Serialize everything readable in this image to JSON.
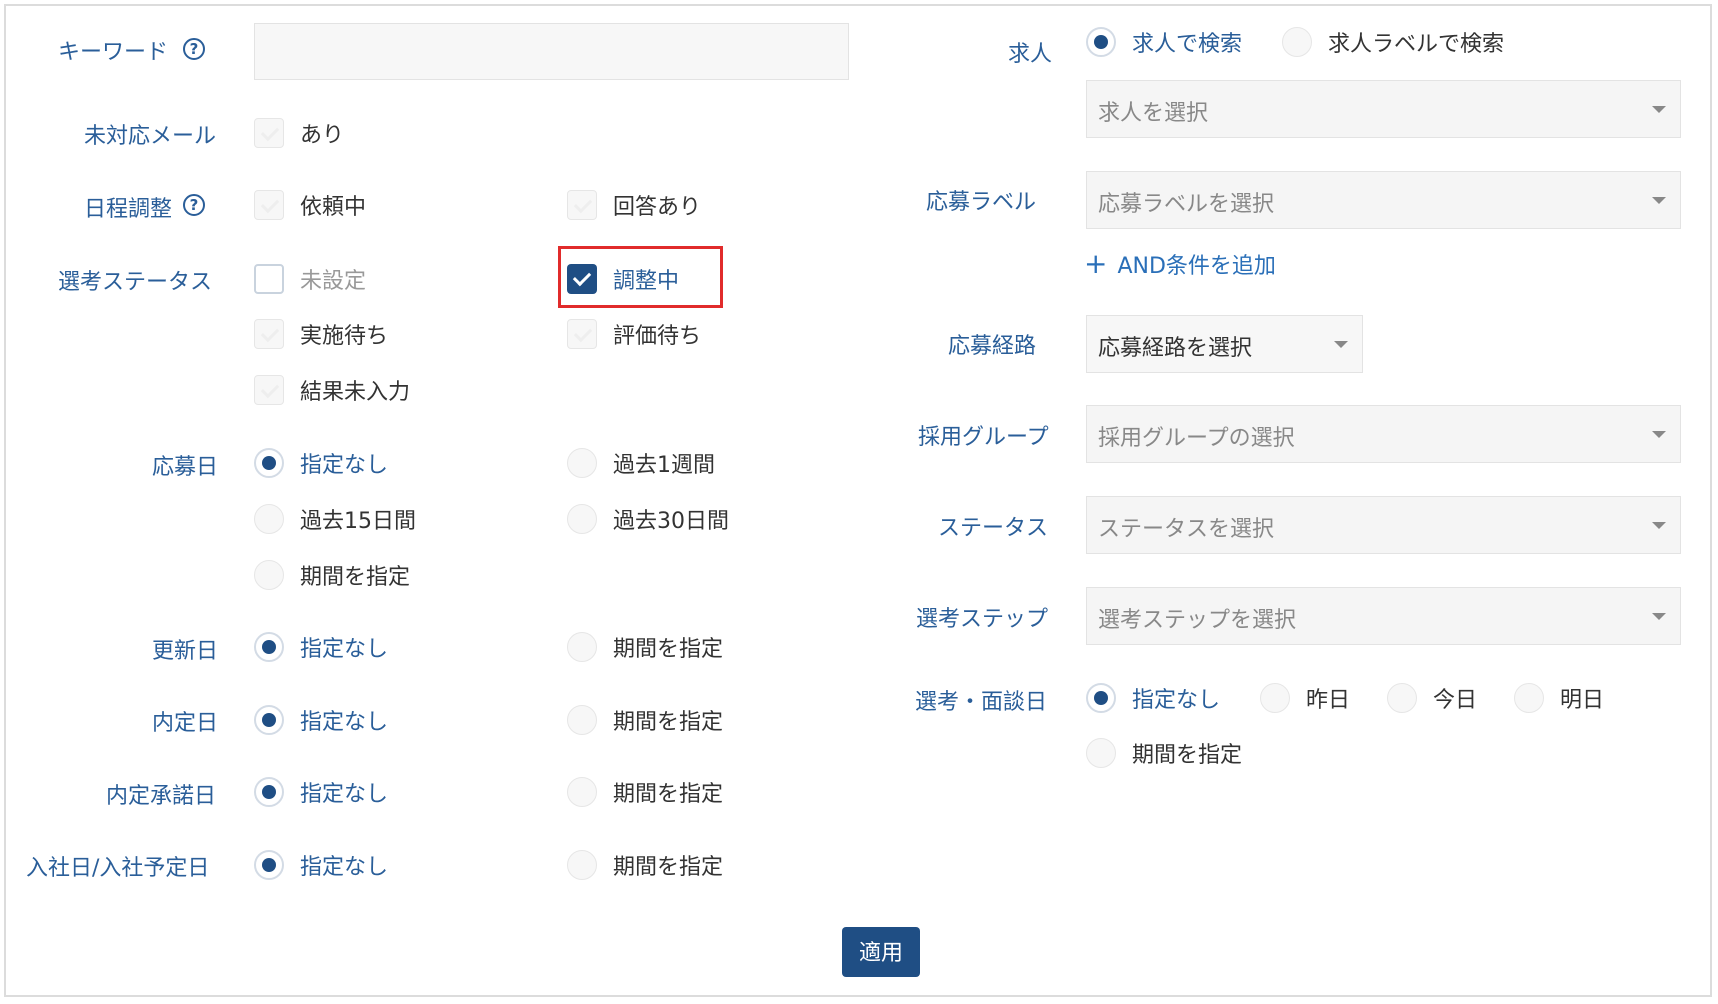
{
  "left": {
    "keyword": {
      "label": "キーワード",
      "help": "?",
      "value": ""
    },
    "unanswered_mail": {
      "label": "未対応メール",
      "option": "あり"
    },
    "schedule": {
      "label": "日程調整",
      "help": "?",
      "options": [
        "依頼中",
        "回答あり"
      ]
    },
    "selection_status": {
      "label": "選考ステータス",
      "options": [
        "未設定",
        "調整中",
        "実施待ち",
        "評価待ち",
        "結果未入力"
      ],
      "checked": "調整中"
    },
    "apply_date": {
      "label": "応募日",
      "options": [
        "指定なし",
        "過去1週間",
        "過去15日間",
        "過去30日間",
        "期間を指定"
      ],
      "selected": "指定なし"
    },
    "updated_date": {
      "label": "更新日",
      "options": [
        "指定なし",
        "期間を指定"
      ],
      "selected": "指定なし"
    },
    "offer_date": {
      "label": "内定日",
      "options": [
        "指定なし",
        "期間を指定"
      ],
      "selected": "指定なし"
    },
    "offer_accept_date": {
      "label": "内定承諾日",
      "options": [
        "指定なし",
        "期間を指定"
      ],
      "selected": "指定なし"
    },
    "join_date": {
      "label": "入社日/入社予定日",
      "options": [
        "指定なし",
        "期間を指定"
      ],
      "selected": "指定なし"
    }
  },
  "right": {
    "job": {
      "label": "求人",
      "options": [
        "求人で検索",
        "求人ラベルで検索"
      ],
      "selected": "求人で検索",
      "select_placeholder": "求人を選択"
    },
    "apply_label": {
      "label": "応募ラベル",
      "select_placeholder": "応募ラベルを選択",
      "add_condition": "AND条件を追加",
      "add_icon": "+"
    },
    "apply_route": {
      "label": "応募経路",
      "select_value": "応募経路を選択"
    },
    "recruit_group": {
      "label": "採用グループ",
      "select_placeholder": "採用グループの選択"
    },
    "status": {
      "label": "ステータス",
      "select_placeholder": "ステータスを選択"
    },
    "selection_step": {
      "label": "選考ステップ",
      "select_placeholder": "選考ステップを選択"
    },
    "interview_date": {
      "label": "選考・面談日",
      "options": [
        "指定なし",
        "昨日",
        "今日",
        "明日",
        "期間を指定"
      ],
      "selected": "指定なし"
    }
  },
  "apply_button": "適用",
  "colors": {
    "accent": "#1f4e84",
    "label": "#2a5e99",
    "highlight": "#e12b2b"
  }
}
